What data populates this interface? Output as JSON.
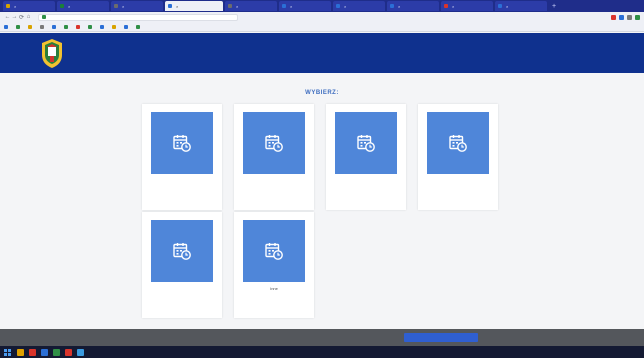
{
  "browser": {
    "tabs": [
      {
        "label": "",
        "favicon": "#d8a300",
        "active": false
      },
      {
        "label": "",
        "favicon": "#1a7f3a",
        "active": false
      },
      {
        "label": "",
        "favicon": "#6c6c6c",
        "active": false
      },
      {
        "label": "",
        "favicon": "#2b6fd6",
        "active": true
      },
      {
        "label": "",
        "favicon": "#6c6c6c",
        "active": false
      },
      {
        "label": "",
        "favicon": "#2b6fd6",
        "active": false
      },
      {
        "label": "",
        "favicon": "#2b6fd6",
        "active": false
      },
      {
        "label": "",
        "favicon": "#2b6fd6",
        "active": false
      },
      {
        "label": "",
        "favicon": "#d9342b",
        "active": false
      },
      {
        "label": "",
        "favicon": "#2b6fd6",
        "active": false
      }
    ],
    "new_tab_icon": "+",
    "nav": {
      "back": "←",
      "forward": "→",
      "reload": "⟳",
      "home": "⌂"
    },
    "url": "",
    "extension_colors": [
      "#d9342b",
      "#2b6fd6",
      "#7a7a7a",
      "#2f8f46"
    ],
    "bookmarks": [
      {
        "label": "",
        "icon": "#2b6fd6"
      },
      {
        "label": "",
        "icon": "#2f8f46"
      },
      {
        "label": "",
        "icon": "#d8a300"
      },
      {
        "label": "",
        "icon": "#7a7a7a"
      },
      {
        "label": "",
        "icon": "#2b6fd6"
      },
      {
        "label": "",
        "icon": "#2f8f46"
      },
      {
        "label": "",
        "icon": "#d9342b"
      },
      {
        "label": "",
        "icon": "#2f8f46"
      },
      {
        "label": "",
        "icon": "#2b6fd6"
      },
      {
        "label": "",
        "icon": "#d8a300"
      },
      {
        "label": "",
        "icon": "#2b6fd6"
      },
      {
        "label": "",
        "icon": "#2f8f46"
      }
    ]
  },
  "header": {
    "logo_icon": "university-crest-icon",
    "brand_color": "#0f318e"
  },
  "main": {
    "heading": "WYBIERZ:",
    "tile_color": "#4f86d9",
    "tile_icon": "calendar-clock-icon",
    "cards": [
      {
        "label": ""
      },
      {
        "label": ""
      },
      {
        "label": ""
      },
      {
        "label": ""
      },
      {
        "label": ""
      },
      {
        "label": "Inne"
      }
    ]
  },
  "cookie_bar": {
    "text": "",
    "accept_label": ""
  },
  "taskbar": {
    "apps": [
      "#e0a100",
      "#d9342b",
      "#2b6fd6",
      "#2f8f46",
      "#d9342b",
      "#3a9be0"
    ],
    "clock_time": "",
    "clock_date": ""
  }
}
